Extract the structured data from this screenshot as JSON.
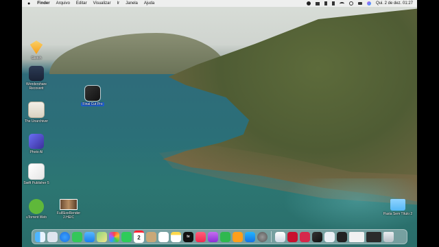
{
  "menubar": {
    "apple": "",
    "app": "Finder",
    "items": [
      "Arquivo",
      "Editar",
      "Visualizar",
      "Ir",
      "Janela",
      "Ajuda"
    ],
    "clock": "Qui. 2 de dez.  01:27"
  },
  "desktop_icons": [
    {
      "label": "Sketch"
    },
    {
      "label": "Wondershare Recoverit"
    },
    {
      "label": "The Unarchiver"
    },
    {
      "label": "Photo AI"
    },
    {
      "label": "Swift Publisher 5"
    },
    {
      "label": "uTorrent Web"
    },
    {
      "label": "FullSizeRender 2.HEIC"
    },
    {
      "label": "Final Cut Pro"
    },
    {
      "label": "Pasta Sem Título 2"
    }
  ],
  "dock": {
    "calendar_day": "2",
    "tv_label": "tv",
    "apps": [
      "Finder",
      "Launchpad",
      "Safari",
      "Messages",
      "Mail",
      "Maps",
      "Photos",
      "FaceTime",
      "Calendar",
      "Contacts",
      "Reminders",
      "Notes",
      "TV",
      "Music",
      "Podcasts",
      "Numbers",
      "Pages",
      "App Store",
      "System Preferences",
      "Preview",
      "Acrobat",
      "Photo Booth",
      "Final Cut Pro",
      "Screenshot",
      "Activity",
      "Trash"
    ]
  }
}
